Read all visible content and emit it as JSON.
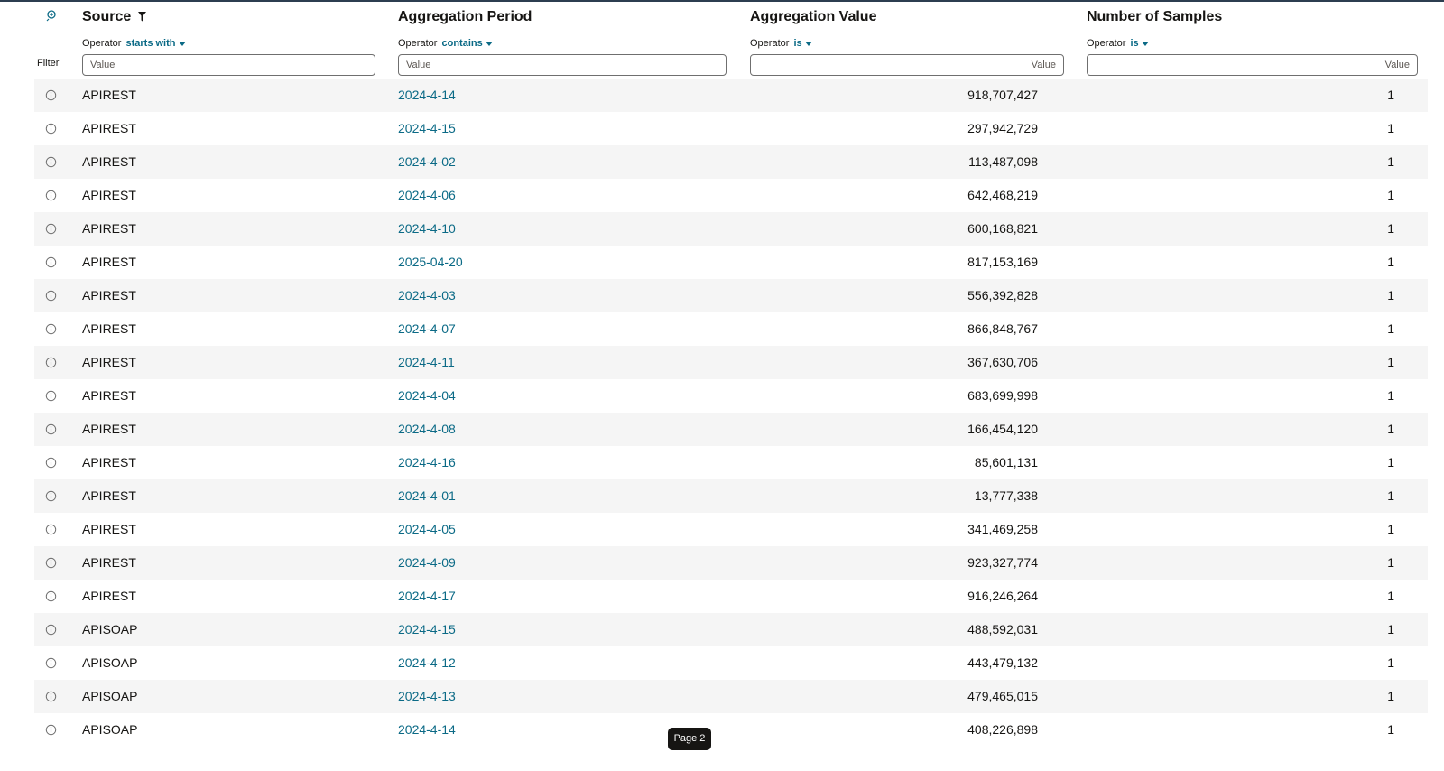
{
  "header": {
    "source": {
      "title": "Source",
      "operator_label": "Operator",
      "operator_value": "starts with",
      "placeholder": "Value"
    },
    "aggregation_period": {
      "title": "Aggregation Period",
      "operator_label": "Operator",
      "operator_value": "contains",
      "placeholder": "Value"
    },
    "aggregation_value": {
      "title": "Aggregation Value",
      "operator_label": "Operator",
      "operator_value": "is",
      "placeholder": "Value"
    },
    "number_of_samples": {
      "title": "Number of Samples",
      "operator_label": "Operator",
      "operator_value": "is",
      "placeholder": "Value"
    },
    "filter_label": "Filter"
  },
  "rows": [
    {
      "source": "APIREST",
      "period": "2024-4-14",
      "value": "918,707,427",
      "samples": "1"
    },
    {
      "source": "APIREST",
      "period": "2024-4-15",
      "value": "297,942,729",
      "samples": "1"
    },
    {
      "source": "APIREST",
      "period": "2024-4-02",
      "value": "113,487,098",
      "samples": "1"
    },
    {
      "source": "APIREST",
      "period": "2024-4-06",
      "value": "642,468,219",
      "samples": "1"
    },
    {
      "source": "APIREST",
      "period": "2024-4-10",
      "value": "600,168,821",
      "samples": "1"
    },
    {
      "source": "APIREST",
      "period": "2025-04-20",
      "value": "817,153,169",
      "samples": "1"
    },
    {
      "source": "APIREST",
      "period": "2024-4-03",
      "value": "556,392,828",
      "samples": "1"
    },
    {
      "source": "APIREST",
      "period": "2024-4-07",
      "value": "866,848,767",
      "samples": "1"
    },
    {
      "source": "APIREST",
      "period": "2024-4-11",
      "value": "367,630,706",
      "samples": "1"
    },
    {
      "source": "APIREST",
      "period": "2024-4-04",
      "value": "683,699,998",
      "samples": "1"
    },
    {
      "source": "APIREST",
      "period": "2024-4-08",
      "value": "166,454,120",
      "samples": "1"
    },
    {
      "source": "APIREST",
      "period": "2024-4-16",
      "value": "85,601,131",
      "samples": "1"
    },
    {
      "source": "APIREST",
      "period": "2024-4-01",
      "value": "13,777,338",
      "samples": "1"
    },
    {
      "source": "APIREST",
      "period": "2024-4-05",
      "value": "341,469,258",
      "samples": "1"
    },
    {
      "source": "APIREST",
      "period": "2024-4-09",
      "value": "923,327,774",
      "samples": "1"
    },
    {
      "source": "APIREST",
      "period": "2024-4-17",
      "value": "916,246,264",
      "samples": "1"
    },
    {
      "source": "APISOAP",
      "period": "2024-4-15",
      "value": "488,592,031",
      "samples": "1"
    },
    {
      "source": "APISOAP",
      "period": "2024-4-12",
      "value": "443,479,132",
      "samples": "1"
    },
    {
      "source": "APISOAP",
      "period": "2024-4-13",
      "value": "479,465,015",
      "samples": "1"
    },
    {
      "source": "APISOAP",
      "period": "2024-4-14",
      "value": "408,226,898",
      "samples": "1"
    }
  ],
  "pager": {
    "label": "Page 2"
  },
  "icons": {
    "sort": "sort-settings-icon",
    "filter": "funnel-icon",
    "row": "info-icon"
  },
  "colors": {
    "link": "#0b6a86",
    "alt_row": "#f5f5f5",
    "pager_bg": "#161513"
  }
}
